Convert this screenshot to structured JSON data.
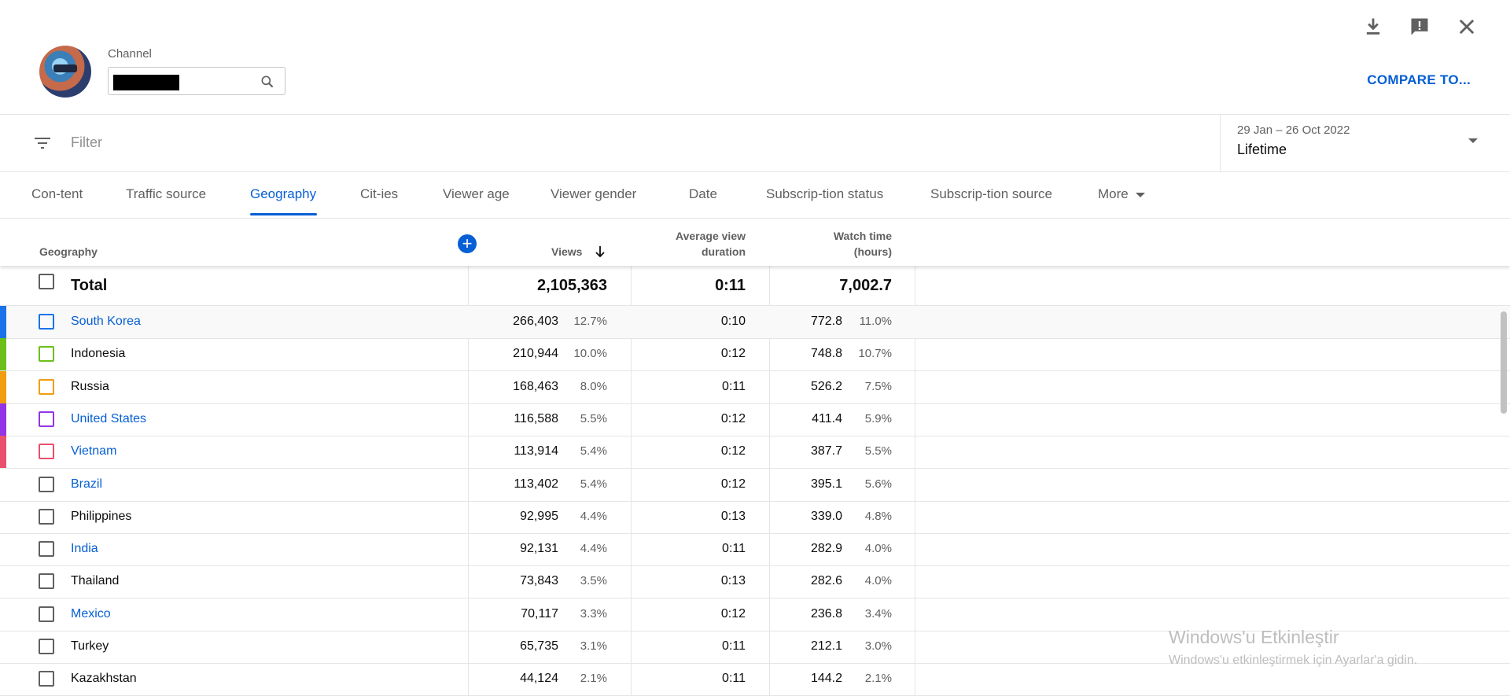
{
  "header": {
    "channel_label": "Channel",
    "compare_label": "COMPARE TO..."
  },
  "filter": {
    "placeholder": "Filter",
    "date_range": "29 Jan – 26 Oct 2022",
    "period": "Lifetime"
  },
  "tabs": [
    {
      "label": "Con-tent"
    },
    {
      "label": "Traffic source"
    },
    {
      "label": "Geography"
    },
    {
      "label": "Cit-ies"
    },
    {
      "label": "Viewer age"
    },
    {
      "label": "Viewer gender"
    },
    {
      "label": "Date"
    },
    {
      "label": "Subscrip-tion status"
    },
    {
      "label": "Subscrip-tion source"
    },
    {
      "label": "More"
    }
  ],
  "table": {
    "headers": {
      "geography": "Geography",
      "views": "Views",
      "avg_view_line1": "Average view",
      "avg_view_line2": "duration",
      "watch_line1": "Watch time",
      "watch_line2": "(hours)"
    },
    "total": {
      "label": "Total",
      "views": "2,105,363",
      "avg": "0:11",
      "watch": "7,002.7"
    },
    "rows": [
      {
        "name": "South Korea",
        "views": "266,403",
        "views_pct": "12.7%",
        "avg": "0:10",
        "watch": "772.8",
        "watch_pct": "11.0%",
        "link": true,
        "color": "#1a73e8"
      },
      {
        "name": "Indonesia",
        "views": "210,944",
        "views_pct": "10.0%",
        "avg": "0:12",
        "watch": "748.8",
        "watch_pct": "10.7%",
        "link": false,
        "color": "#6cbf1b"
      },
      {
        "name": "Russia",
        "views": "168,463",
        "views_pct": "8.0%",
        "avg": "0:11",
        "watch": "526.2",
        "watch_pct": "7.5%",
        "link": false,
        "color": "#f29c11"
      },
      {
        "name": "United States",
        "views": "116,588",
        "views_pct": "5.5%",
        "avg": "0:12",
        "watch": "411.4",
        "watch_pct": "5.9%",
        "link": true,
        "color": "#9334e6"
      },
      {
        "name": "Vietnam",
        "views": "113,914",
        "views_pct": "5.4%",
        "avg": "0:12",
        "watch": "387.7",
        "watch_pct": "5.5%",
        "link": true,
        "color": "#e8506c"
      },
      {
        "name": "Brazil",
        "views": "113,402",
        "views_pct": "5.4%",
        "avg": "0:12",
        "watch": "395.1",
        "watch_pct": "5.6%",
        "link": true,
        "color": ""
      },
      {
        "name": "Philippines",
        "views": "92,995",
        "views_pct": "4.4%",
        "avg": "0:13",
        "watch": "339.0",
        "watch_pct": "4.8%",
        "link": false,
        "color": ""
      },
      {
        "name": "India",
        "views": "92,131",
        "views_pct": "4.4%",
        "avg": "0:11",
        "watch": "282.9",
        "watch_pct": "4.0%",
        "link": true,
        "color": ""
      },
      {
        "name": "Thailand",
        "views": "73,843",
        "views_pct": "3.5%",
        "avg": "0:13",
        "watch": "282.6",
        "watch_pct": "4.0%",
        "link": false,
        "color": ""
      },
      {
        "name": "Mexico",
        "views": "70,117",
        "views_pct": "3.3%",
        "avg": "0:12",
        "watch": "236.8",
        "watch_pct": "3.4%",
        "link": true,
        "color": ""
      },
      {
        "name": "Turkey",
        "views": "65,735",
        "views_pct": "3.1%",
        "avg": "0:11",
        "watch": "212.1",
        "watch_pct": "3.0%",
        "link": false,
        "color": ""
      },
      {
        "name": "Kazakhstan",
        "views": "44,124",
        "views_pct": "2.1%",
        "avg": "0:11",
        "watch": "144.2",
        "watch_pct": "2.1%",
        "link": false,
        "color": ""
      }
    ]
  },
  "watermark": {
    "line1": "Windows'u Etkinleştir",
    "line2": "Windows'u etkinleştirmek için Ayarlar'a gidin."
  },
  "icons": [
    "download-icon",
    "feedback-icon",
    "close-icon",
    "search-icon",
    "filter-icon",
    "sort-down-icon",
    "add-icon"
  ]
}
